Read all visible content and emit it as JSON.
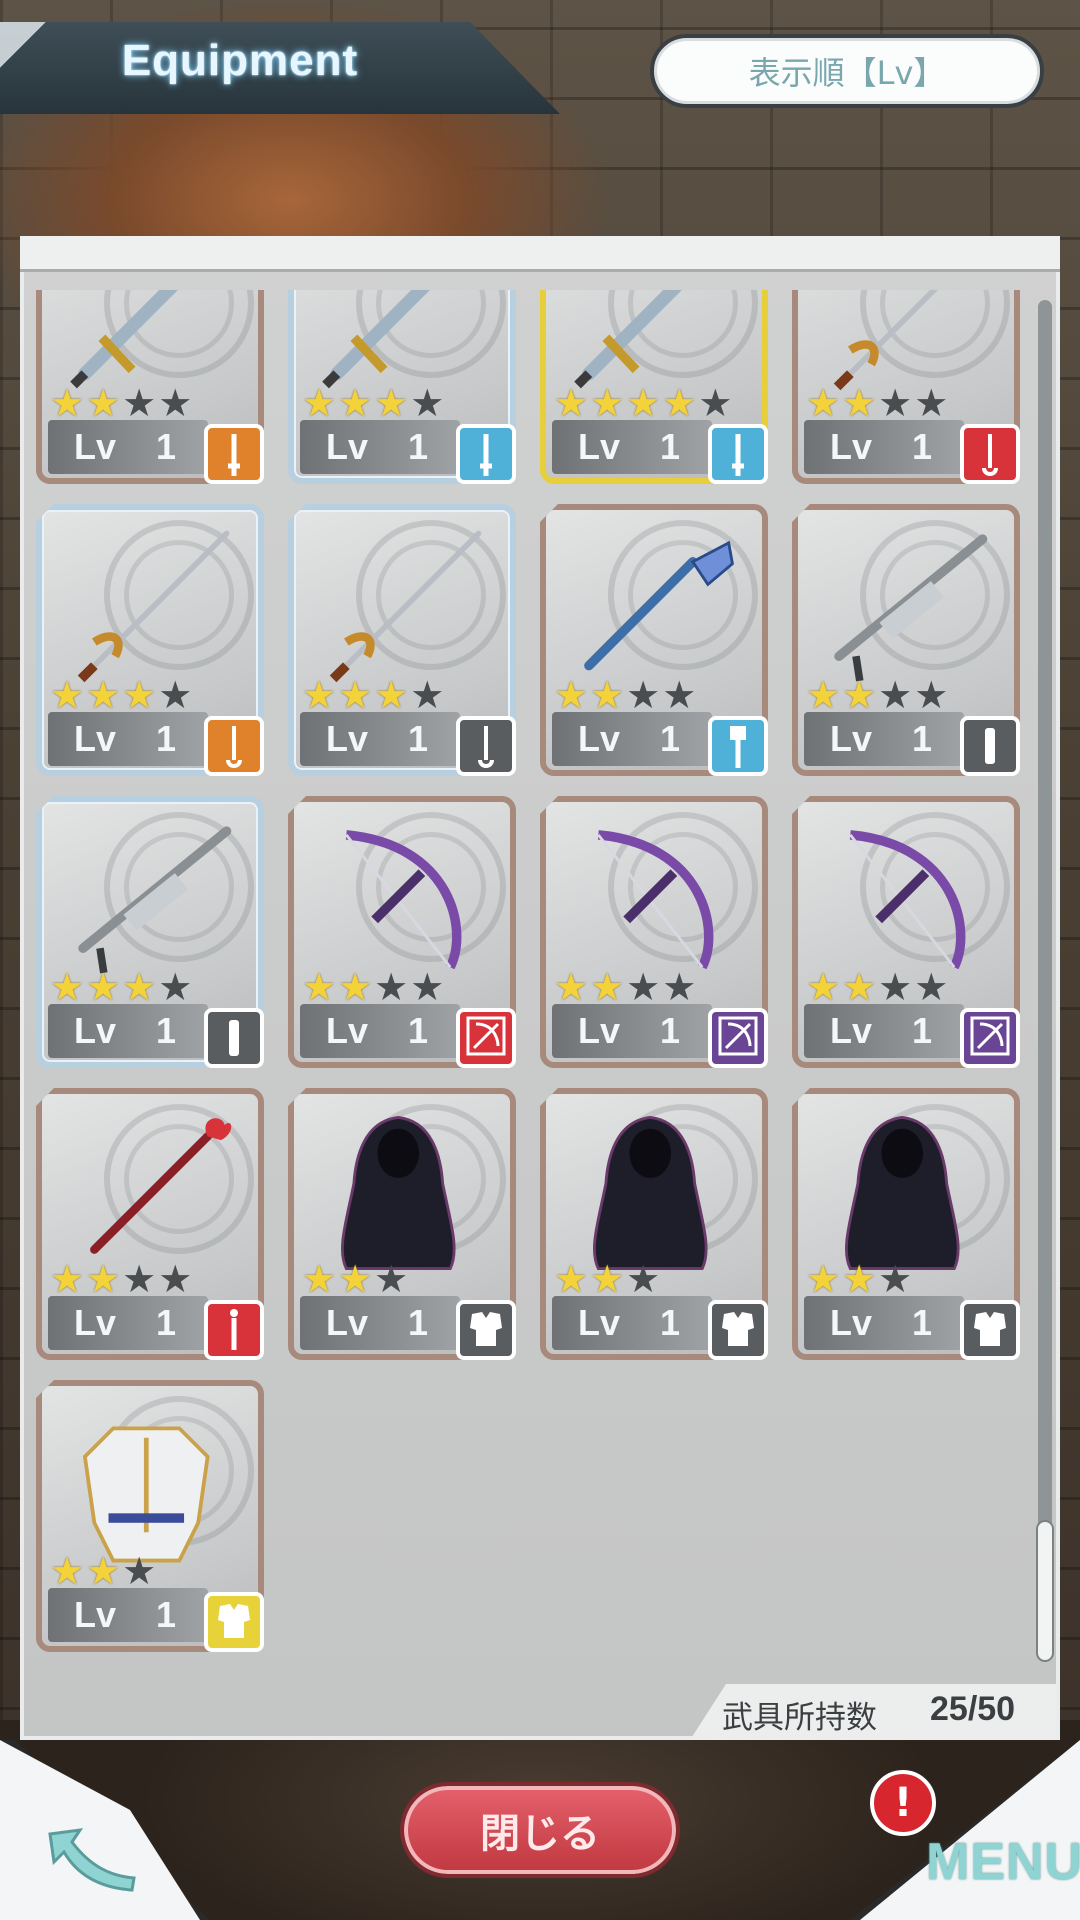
{
  "header": {
    "title": "Equipment",
    "sort_label": "表示順【Lv】"
  },
  "inventory": {
    "count_label": "武具所持数",
    "count_value": "25/50",
    "items": [
      {
        "level_prefix": "Lv",
        "level": "1",
        "stars": 2,
        "max_stars": 4,
        "rarity": "bronze",
        "type": "sword",
        "type_color": "#e0822b",
        "art": "sword"
      },
      {
        "level_prefix": "Lv",
        "level": "1",
        "stars": 3,
        "max_stars": 4,
        "rarity": "silver",
        "type": "sword",
        "type_color": "#4fb0d8",
        "art": "sword"
      },
      {
        "level_prefix": "Lv",
        "level": "1",
        "stars": 4,
        "max_stars": 5,
        "rarity": "gold",
        "type": "sword",
        "type_color": "#4fb0d8",
        "art": "sword"
      },
      {
        "level_prefix": "Lv",
        "level": "1",
        "stars": 2,
        "max_stars": 4,
        "rarity": "bronze",
        "type": "rapier",
        "type_color": "#d8323b",
        "art": "rapier"
      },
      {
        "level_prefix": "Lv",
        "level": "1",
        "stars": 3,
        "max_stars": 4,
        "rarity": "silver",
        "type": "rapier",
        "type_color": "#e0822b",
        "art": "rapier"
      },
      {
        "level_prefix": "Lv",
        "level": "1",
        "stars": 3,
        "max_stars": 4,
        "rarity": "silver",
        "type": "rapier",
        "type_color": "#5a5d60",
        "art": "rapier"
      },
      {
        "level_prefix": "Lv",
        "level": "1",
        "stars": 2,
        "max_stars": 4,
        "rarity": "bronze",
        "type": "mace",
        "type_color": "#4fb0d8",
        "art": "mace"
      },
      {
        "level_prefix": "Lv",
        "level": "1",
        "stars": 2,
        "max_stars": 4,
        "rarity": "bronze",
        "type": "gun",
        "type_color": "#5a5d60",
        "art": "gun"
      },
      {
        "level_prefix": "Lv",
        "level": "1",
        "stars": 3,
        "max_stars": 4,
        "rarity": "silver",
        "type": "gun",
        "type_color": "#5a5d60",
        "art": "gun"
      },
      {
        "level_prefix": "Lv",
        "level": "1",
        "stars": 2,
        "max_stars": 4,
        "rarity": "bronze",
        "type": "bow",
        "type_color": "#d8323b",
        "art": "bow"
      },
      {
        "level_prefix": "Lv",
        "level": "1",
        "stars": 2,
        "max_stars": 4,
        "rarity": "bronze",
        "type": "bow",
        "type_color": "#6a4596",
        "art": "bow"
      },
      {
        "level_prefix": "Lv",
        "level": "1",
        "stars": 2,
        "max_stars": 4,
        "rarity": "bronze",
        "type": "bow",
        "type_color": "#6a4596",
        "art": "bow"
      },
      {
        "level_prefix": "Lv",
        "level": "1",
        "stars": 2,
        "max_stars": 4,
        "rarity": "bronze",
        "type": "staff",
        "type_color": "#d8323b",
        "art": "staff"
      },
      {
        "level_prefix": "Lv",
        "level": "1",
        "stars": 2,
        "max_stars": 3,
        "rarity": "bronze",
        "type": "armor",
        "type_color": "#5a5d60",
        "art": "cloak"
      },
      {
        "level_prefix": "Lv",
        "level": "1",
        "stars": 2,
        "max_stars": 3,
        "rarity": "bronze",
        "type": "armor",
        "type_color": "#5a5d60",
        "art": "cloak"
      },
      {
        "level_prefix": "Lv",
        "level": "1",
        "stars": 2,
        "max_stars": 3,
        "rarity": "bronze",
        "type": "armor",
        "type_color": "#5a5d60",
        "art": "cloak"
      },
      {
        "level_prefix": "Lv",
        "level": "1",
        "stars": 2,
        "max_stars": 3,
        "rarity": "bronze",
        "type": "armor",
        "type_color": "#e8d23a",
        "art": "armor"
      }
    ]
  },
  "footer": {
    "close_label": "閉じる",
    "menu_label": "MENU",
    "alert_badge": "!"
  }
}
